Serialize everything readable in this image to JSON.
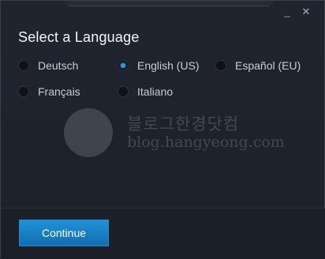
{
  "window": {
    "title": "Select a Language",
    "minimize_glyph": "_",
    "close_glyph": "✕"
  },
  "languages": [
    {
      "label": "Deutsch",
      "checked": false
    },
    {
      "label": "English (US)",
      "checked": true
    },
    {
      "label": "Español (EU)",
      "checked": false
    },
    {
      "label": "Français",
      "checked": false
    },
    {
      "label": "Italiano",
      "checked": false
    }
  ],
  "watermark": {
    "line1": "블로그한경닷컴",
    "line2": "blog.hangyeong.com"
  },
  "footer": {
    "continue_label": "Continue"
  },
  "colors": {
    "accent": "#1e92d8",
    "background": "#1d212b"
  }
}
